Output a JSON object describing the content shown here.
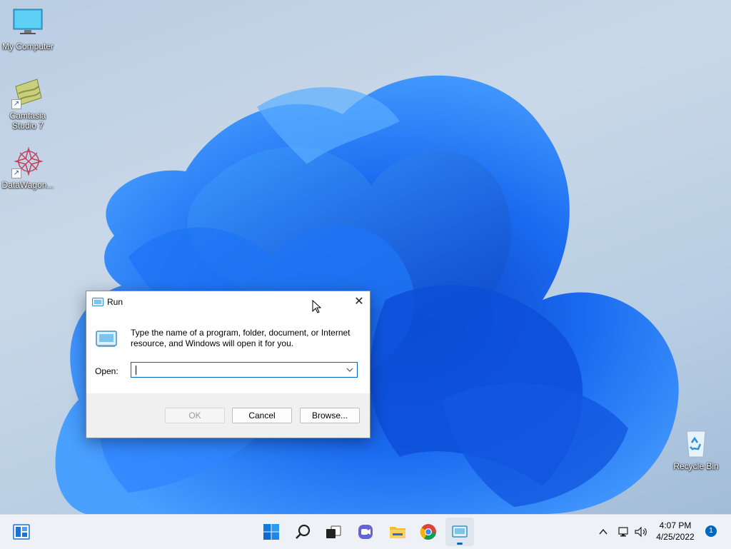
{
  "desktop": {
    "icons": [
      {
        "label": "My Computer"
      },
      {
        "label_line1": "Camtasia",
        "label_line2": "Studio 7"
      },
      {
        "label": "DataWagon..."
      },
      {
        "label": "Recycle Bin"
      }
    ]
  },
  "run_dialog": {
    "title": "Run",
    "close_glyph": "✕",
    "description": "Type the name of a program, folder, document, or Internet resource, and Windows will open it for you.",
    "open_label": "Open:",
    "open_value": "",
    "ok_label": "OK",
    "cancel_label": "Cancel",
    "browse_label": "Browse..."
  },
  "taskbar": {
    "time": "4:07 PM",
    "date": "4/25/2022",
    "notification_count": "1",
    "apps": [
      "widgets",
      "start",
      "search",
      "task-view",
      "chat",
      "file-explorer",
      "chrome",
      "run"
    ]
  },
  "colors": {
    "accent": "#0067c0",
    "taskbar_bg": "#eef2f6",
    "dialog_bg": "#f0f0f0"
  }
}
